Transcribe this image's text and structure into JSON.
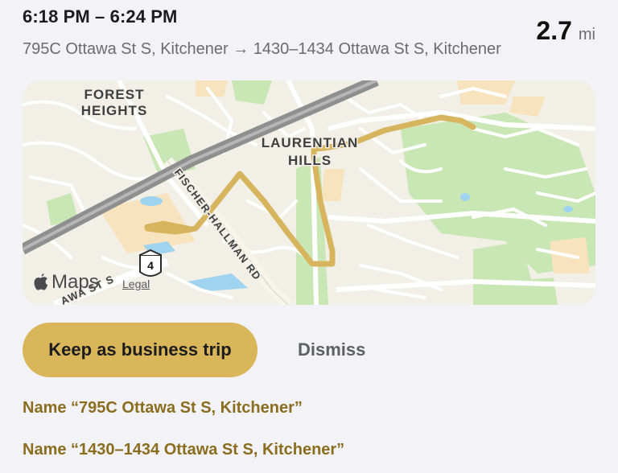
{
  "trip": {
    "time_range": "6:18 PM – 6:24 PM",
    "route": "795C Ottawa St S, Kitchener → 1430–1434 Ottawa St S, Kitchener",
    "distance_value": "2.7",
    "distance_unit": "mi"
  },
  "map": {
    "labels": {
      "forest": "FOREST",
      "heights": "HEIGHTS",
      "laurentian": "LAURENTIAN",
      "hills": "HILLS",
      "road": "FISCHER-HALLMAN RD",
      "ottawa": "AWA ST S",
      "highway_shield": "4"
    },
    "logo_text": "Maps",
    "legal_text": "Legal",
    "route_color": "#d7b55f"
  },
  "actions": {
    "keep_label": "Keep as business trip",
    "dismiss_label": "Dismiss",
    "name_start": "Name “795C Ottawa St S, Kitchener”",
    "name_end": "Name “1430–1434 Ottawa St S, Kitchener”"
  }
}
